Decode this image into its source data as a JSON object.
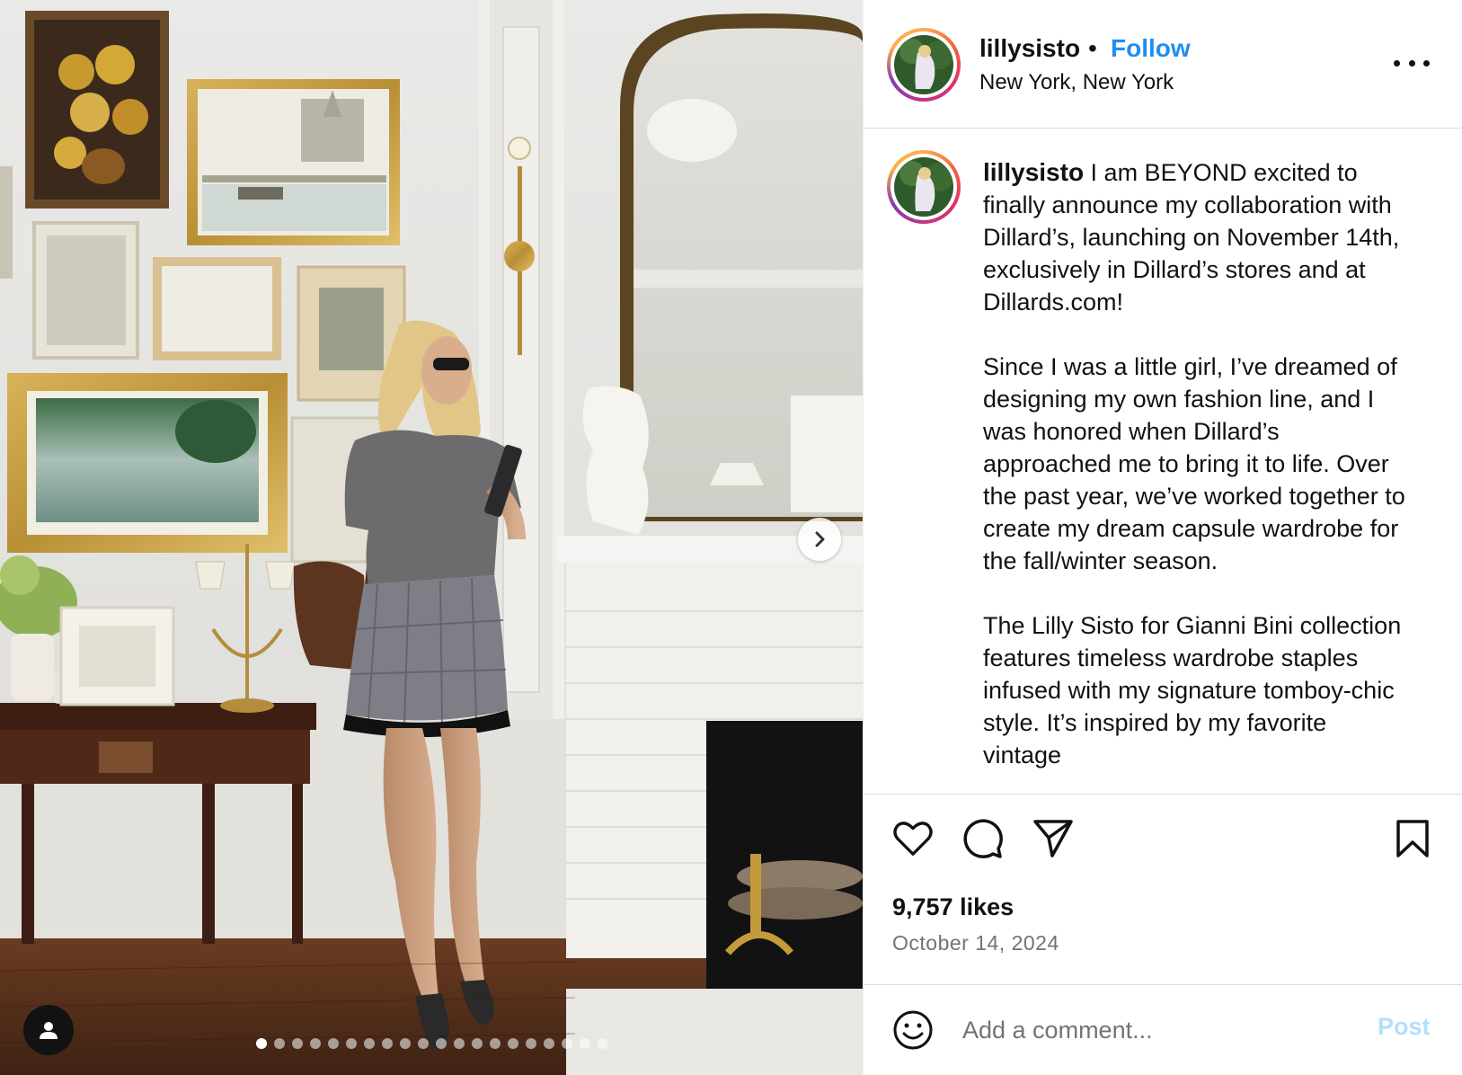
{
  "post": {
    "username": "lillysisto",
    "follow_label": "Follow",
    "separator": "•",
    "location": "New York, New York",
    "caption_text": " I am BEYOND excited to finally announce my collaboration with Dillard’s, launching on November 14th, exclusively in Dillard’s stores and at Dillards.com!\n\nSince I was a little girl, I’ve dreamed of designing my own fashion line, and I was honored when Dillard’s approached me to bring it to life. Over the past year, we’ve worked together to create my dream capsule wardrobe for the fall/winter season.\n\nThe Lilly Sisto for Gianni Bini collection features timeless wardrobe staples infused with my signature tomboy-chic style. It’s inspired by my favorite vintage",
    "likes": "9,757 likes",
    "date": "October 14, 2024"
  },
  "carousel": {
    "total_slides": 20,
    "active_index": 0
  },
  "icons": {
    "more": "more-options-icon",
    "like": "heart-icon",
    "comment": "comment-icon",
    "share": "share-icon",
    "save": "bookmark-icon",
    "emoji": "emoji-icon",
    "next": "chevron-right-icon",
    "tag": "user-tag-icon"
  },
  "comment": {
    "placeholder": "Add a comment...",
    "post_label": "Post"
  },
  "colors": {
    "follow": "#1f8ef1",
    "post_disabled": "#b2dffc",
    "muted": "#737373",
    "divider": "#dbdbdb"
  }
}
